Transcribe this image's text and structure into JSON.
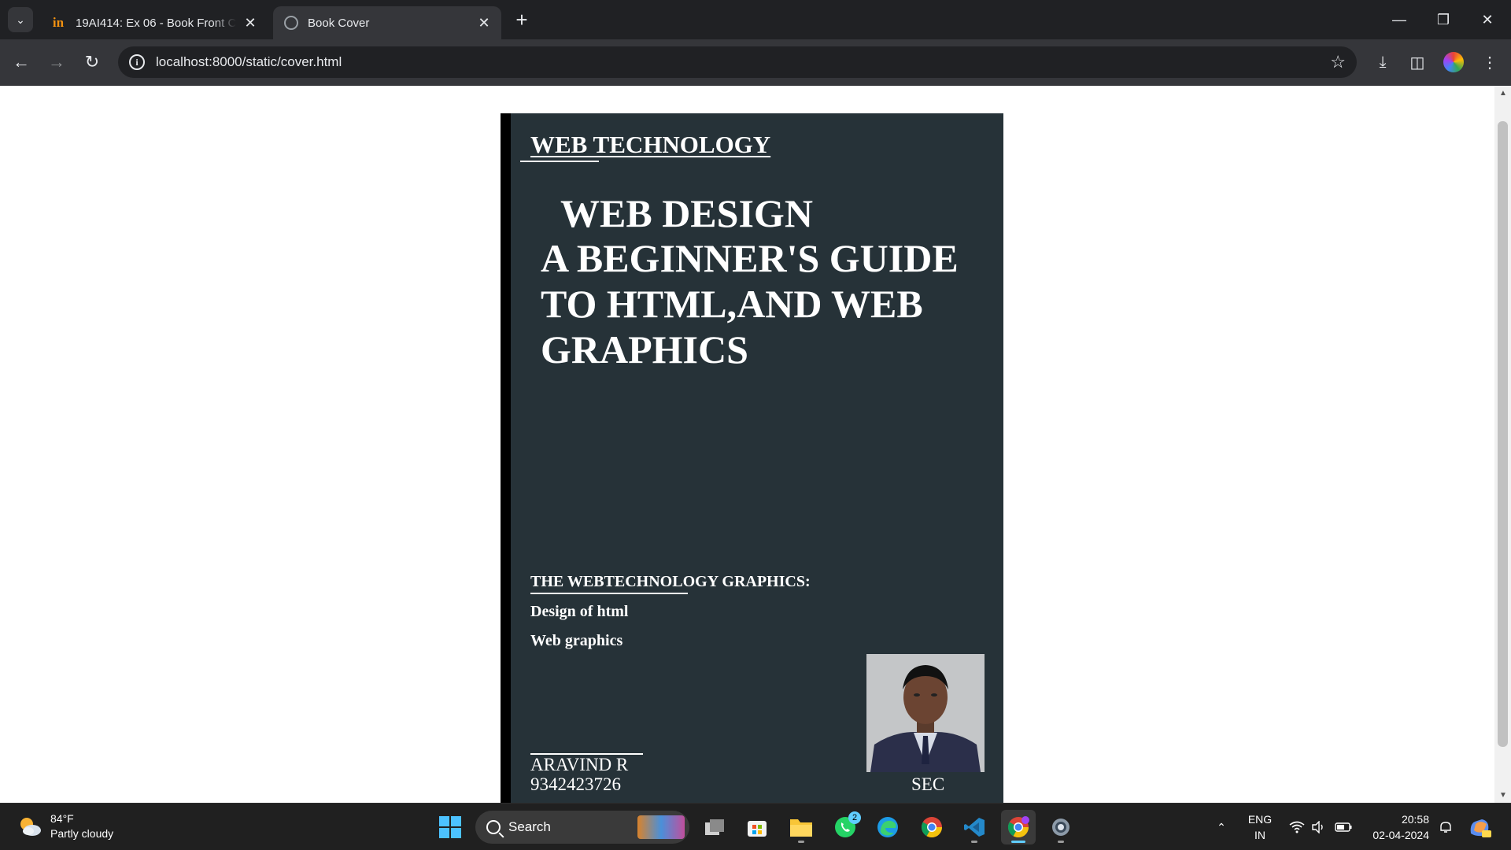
{
  "browser": {
    "tabs": [
      {
        "title": "19AI414: Ex 06 - Book Front Co",
        "icon": "moodle-in-icon",
        "active": false
      },
      {
        "title": "Book Cover",
        "icon": "globe-icon",
        "active": true
      }
    ],
    "url": "localhost:8000/static/cover.html"
  },
  "cover": {
    "series_title": "WEB TECHNOLOGY",
    "headline": "WEB DESIGN",
    "subtitle": "A BEGINNER'S GUIDE TO HTML,AND WEB GRAPHICS",
    "topics_heading": "THE WEBTECHNOLOGY GRAPHICS:",
    "topics": [
      "Design of html",
      "Web graphics"
    ],
    "author_name": "ARAVIND R",
    "author_phone": "9342423726",
    "organization": "SEC",
    "colors": {
      "cover_bg": "#263238",
      "spine": "#000000",
      "text": "#ffffff"
    }
  },
  "taskbar": {
    "weather_temp": "84°F",
    "weather_desc": "Partly cloudy",
    "search_label": "Search",
    "whatsapp_badge": "2",
    "lang_primary": "ENG",
    "lang_secondary": "IN",
    "time": "20:58",
    "date": "02-04-2024"
  }
}
